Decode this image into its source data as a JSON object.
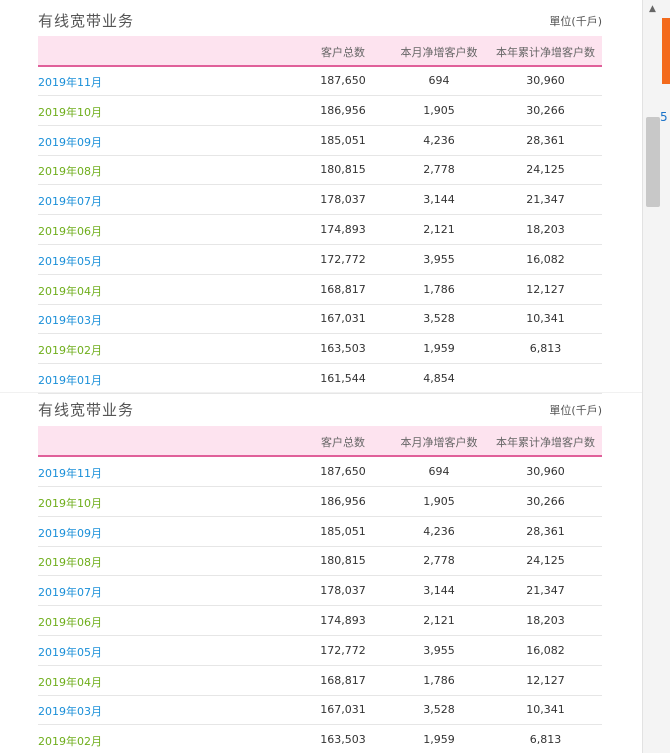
{
  "table_title": "有线宽带业务",
  "unit_label": "單位(千戶)",
  "columns": [
    "客户总数",
    "本月净增客户数",
    "本年累计净增客户数"
  ],
  "rows_top": [
    {
      "month": "2019年11月",
      "total": "187,650",
      "net_month": "694",
      "net_year": "30,960",
      "month_color": "blue"
    },
    {
      "month": "2019年10月",
      "total": "186,956",
      "net_month": "1,905",
      "net_year": "30,266",
      "month_color": "green"
    },
    {
      "month": "2019年09月",
      "total": "185,051",
      "net_month": "4,236",
      "net_year": "28,361",
      "month_color": "blue"
    },
    {
      "month": "2019年08月",
      "total": "180,815",
      "net_month": "2,778",
      "net_year": "24,125",
      "month_color": "green"
    },
    {
      "month": "2019年07月",
      "total": "178,037",
      "net_month": "3,144",
      "net_year": "21,347",
      "month_color": "blue"
    },
    {
      "month": "2019年06月",
      "total": "174,893",
      "net_month": "2,121",
      "net_year": "18,203",
      "month_color": "green"
    },
    {
      "month": "2019年05月",
      "total": "172,772",
      "net_month": "3,955",
      "net_year": "16,082",
      "month_color": "blue"
    },
    {
      "month": "2019年04月",
      "total": "168,817",
      "net_month": "1,786",
      "net_year": "12,127",
      "month_color": "green"
    },
    {
      "month": "2019年03月",
      "total": "167,031",
      "net_month": "3,528",
      "net_year": "10,341",
      "month_color": "blue"
    },
    {
      "month": "2019年02月",
      "total": "163,503",
      "net_month": "1,959",
      "net_year": "6,813",
      "month_color": "green"
    },
    {
      "month": "2019年01月",
      "total": "161,544",
      "net_month": "4,854",
      "net_year": "",
      "month_color": "blue"
    }
  ],
  "rows_bottom": [
    {
      "month": "2019年11月",
      "total": "187,650",
      "net_month": "694",
      "net_year": "30,960",
      "month_color": "blue"
    },
    {
      "month": "2019年10月",
      "total": "186,956",
      "net_month": "1,905",
      "net_year": "30,266",
      "month_color": "green"
    },
    {
      "month": "2019年09月",
      "total": "185,051",
      "net_month": "4,236",
      "net_year": "28,361",
      "month_color": "blue"
    },
    {
      "month": "2019年08月",
      "total": "180,815",
      "net_month": "2,778",
      "net_year": "24,125",
      "month_color": "green"
    },
    {
      "month": "2019年07月",
      "total": "178,037",
      "net_month": "3,144",
      "net_year": "21,347",
      "month_color": "blue"
    },
    {
      "month": "2019年06月",
      "total": "174,893",
      "net_month": "2,121",
      "net_year": "18,203",
      "month_color": "green"
    },
    {
      "month": "2019年05月",
      "total": "172,772",
      "net_month": "3,955",
      "net_year": "16,082",
      "month_color": "blue"
    },
    {
      "month": "2019年04月",
      "total": "168,817",
      "net_month": "1,786",
      "net_year": "12,127",
      "month_color": "green"
    },
    {
      "month": "2019年03月",
      "total": "167,031",
      "net_month": "3,528",
      "net_year": "10,341",
      "month_color": "blue"
    },
    {
      "month": "2019年02月",
      "total": "163,503",
      "net_month": "1,959",
      "net_year": "6,813",
      "month_color": "green"
    }
  ],
  "colors": {
    "header_bg": "#fde3ef",
    "header_line": "#e0609a",
    "month_blue": "#1a8fd8",
    "month_green": "#6fae1c"
  },
  "sidebar": {
    "digit": "5",
    "scroll_up_icon": "triangle-up-icon"
  }
}
